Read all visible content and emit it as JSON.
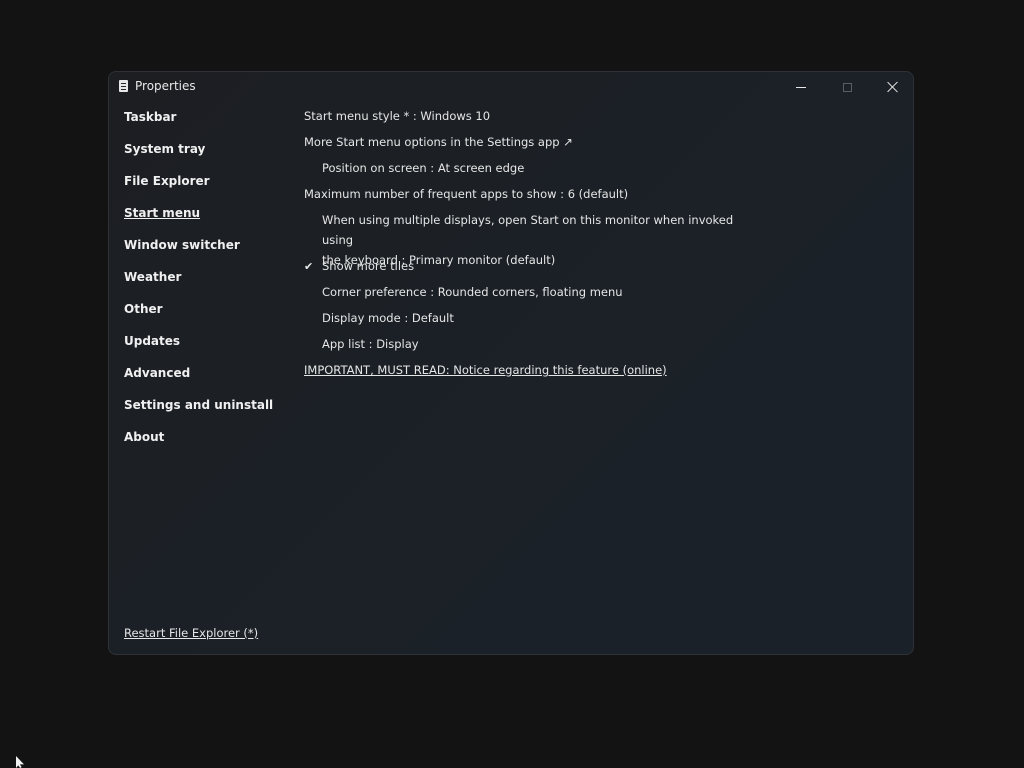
{
  "window": {
    "title": "Properties",
    "icon": "document-icon"
  },
  "sidebar": {
    "items": [
      {
        "label": "Taskbar"
      },
      {
        "label": "System tray"
      },
      {
        "label": "File Explorer"
      },
      {
        "label": "Start menu",
        "active": true
      },
      {
        "label": "Window switcher"
      },
      {
        "label": "Weather"
      },
      {
        "label": "Other"
      },
      {
        "label": "Updates"
      },
      {
        "label": "Advanced"
      },
      {
        "label": "Settings and uninstall"
      },
      {
        "label": "About"
      }
    ],
    "restart_label": "Restart File Explorer (*)"
  },
  "content": {
    "start_menu_style": "Start menu style * : Windows 10",
    "more_options": "More Start menu options in the Settings app ↗",
    "position_on_screen": "Position on screen : At screen edge",
    "max_frequent_apps": "Maximum number of frequent apps to show : 6 (default)",
    "multi_display_line1": "When using multiple displays, open Start on this monitor when invoked using",
    "multi_display_line2": "the keyboard : Primary monitor (default)",
    "show_more_tiles": "Show more tiles",
    "show_more_tiles_checked": true,
    "corner_preference": "Corner preference : Rounded corners, floating menu",
    "display_mode": "Display mode : Default",
    "app_list": "App list : Display",
    "important_notice": "IMPORTANT, MUST READ: Notice regarding this feature (online)"
  },
  "colors": {
    "desktop_bg": "#131313",
    "window_bg": "#1b2127",
    "text": "#e6e6e6"
  }
}
